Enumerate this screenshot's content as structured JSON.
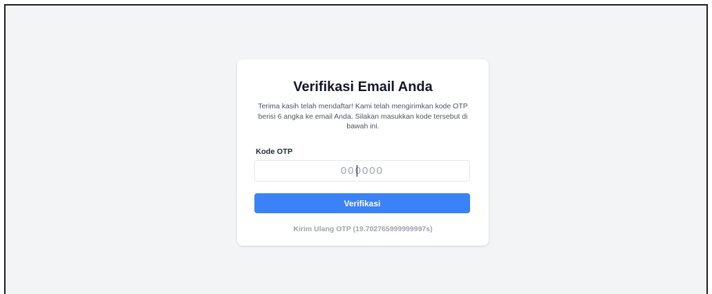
{
  "card": {
    "title": "Verifikasi Email Anda",
    "description": "Terima kasih telah mendaftar! Kami telah mengirimkan kode OTP berisi 6 angka ke email Anda. Silakan masukkan kode tersebut di bawah ini."
  },
  "otp": {
    "label": "Kode OTP",
    "placeholder": "000000",
    "value": ""
  },
  "actions": {
    "verify_label": "Verifikasi",
    "resend_label": "Kirim Ulang OTP (19.702765999999997s)"
  },
  "colors": {
    "page_background": "#f3f4f6",
    "card_background": "#ffffff",
    "primary_button": "#3b82f6",
    "muted_text": "#9ca3af"
  }
}
